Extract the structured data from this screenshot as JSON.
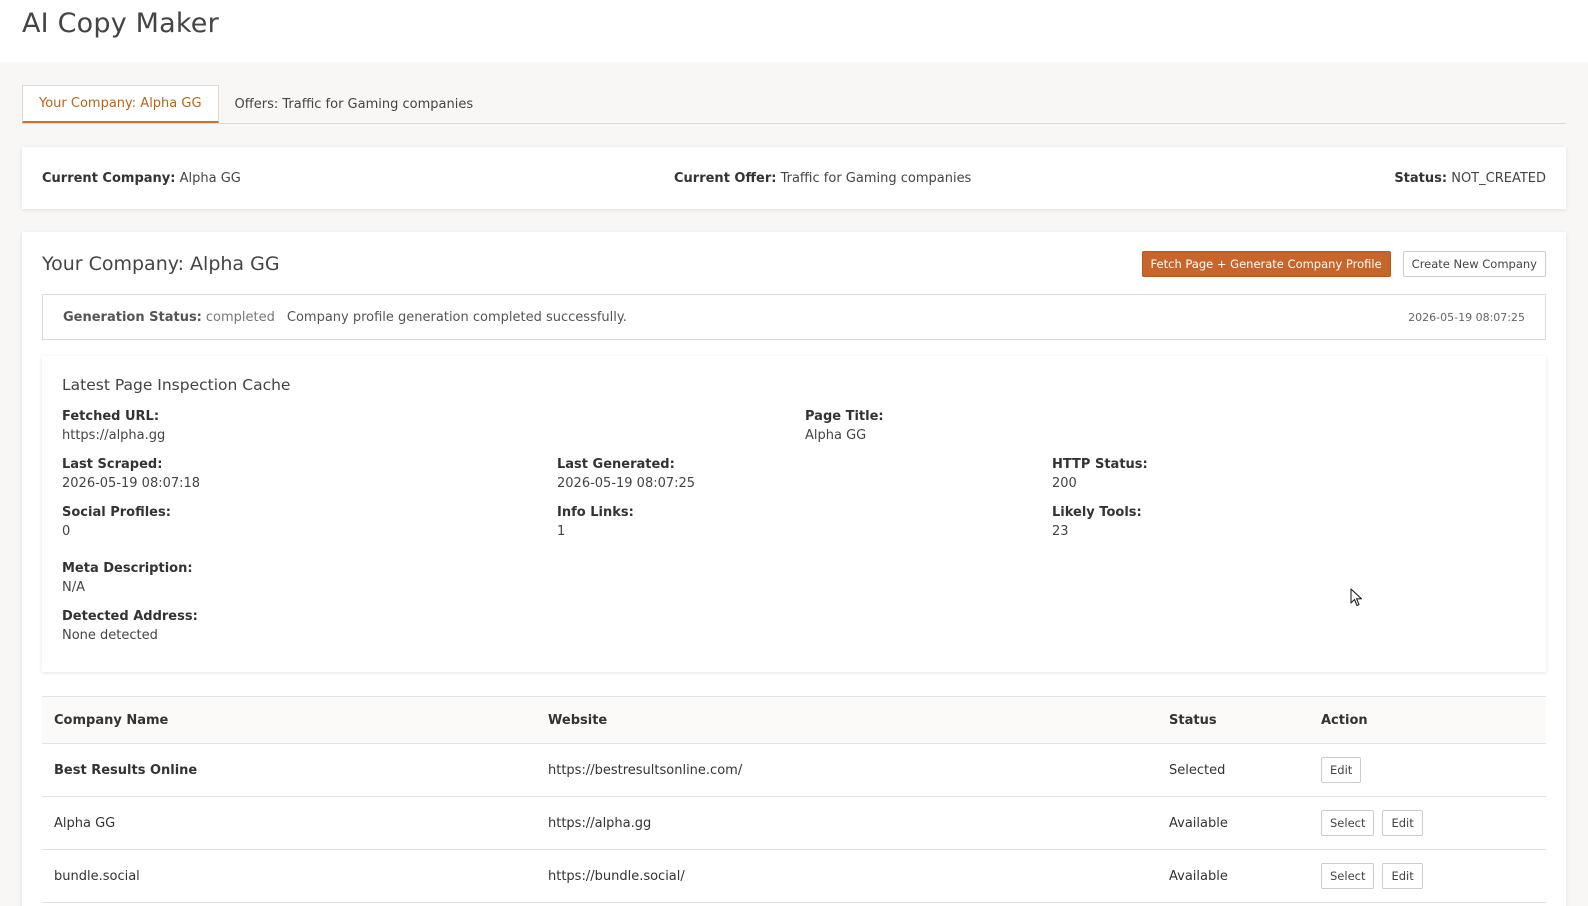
{
  "app": {
    "title": "AI Copy Maker"
  },
  "tabs": [
    {
      "label": "Your Company: Alpha GG",
      "active": true
    },
    {
      "label": "Offers: Traffic for Gaming companies",
      "active": false
    }
  ],
  "status_bar": {
    "company_label": "Current Company:",
    "company_value": "Alpha GG",
    "offer_label": "Current Offer:",
    "offer_value": "Traffic for Gaming companies",
    "status_label": "Status:",
    "status_value": "NOT_CREATED"
  },
  "company_panel": {
    "title": "Your Company: Alpha GG",
    "fetch_button": "Fetch Page + Generate Company Profile",
    "create_button": "Create New Company",
    "generation": {
      "label": "Generation Status:",
      "value": "completed",
      "message": "Company profile generation completed successfully.",
      "timestamp": "2026-05-19 08:07:25"
    },
    "cache": {
      "title": "Latest Page Inspection Cache",
      "fetched_url_label": "Fetched URL:",
      "fetched_url": "https://alpha.gg",
      "page_title_label": "Page Title:",
      "page_title": "Alpha GG",
      "last_scraped_label": "Last Scraped:",
      "last_scraped": "2026-05-19 08:07:18",
      "last_generated_label": "Last Generated:",
      "last_generated": "2026-05-19 08:07:25",
      "http_status_label": "HTTP Status:",
      "http_status": "200",
      "social_profiles_label": "Social Profiles:",
      "social_profiles": "0",
      "info_links_label": "Info Links:",
      "info_links": "1",
      "likely_tools_label": "Likely Tools:",
      "likely_tools": "23",
      "meta_description_label": "Meta Description:",
      "meta_description": "N/A",
      "detected_address_label": "Detected Address:",
      "detected_address": "None detected"
    },
    "table": {
      "headers": {
        "name": "Company Name",
        "website": "Website",
        "status": "Status",
        "action": "Action"
      },
      "rows": [
        {
          "name": "Best Results Online",
          "website": "https://bestresultsonline.com/",
          "status": "Selected",
          "edit": "Edit"
        },
        {
          "name": "Alpha GG",
          "website": "https://alpha.gg",
          "status": "Available",
          "select": "Select",
          "edit": "Edit"
        },
        {
          "name": "bundle.social",
          "website": "https://bundle.social/",
          "status": "Available",
          "select": "Select",
          "edit": "Edit"
        }
      ]
    }
  },
  "colors": {
    "accent": "#c7652a",
    "tab_active_text": "#b8651b",
    "background": "#f9f7f5"
  }
}
